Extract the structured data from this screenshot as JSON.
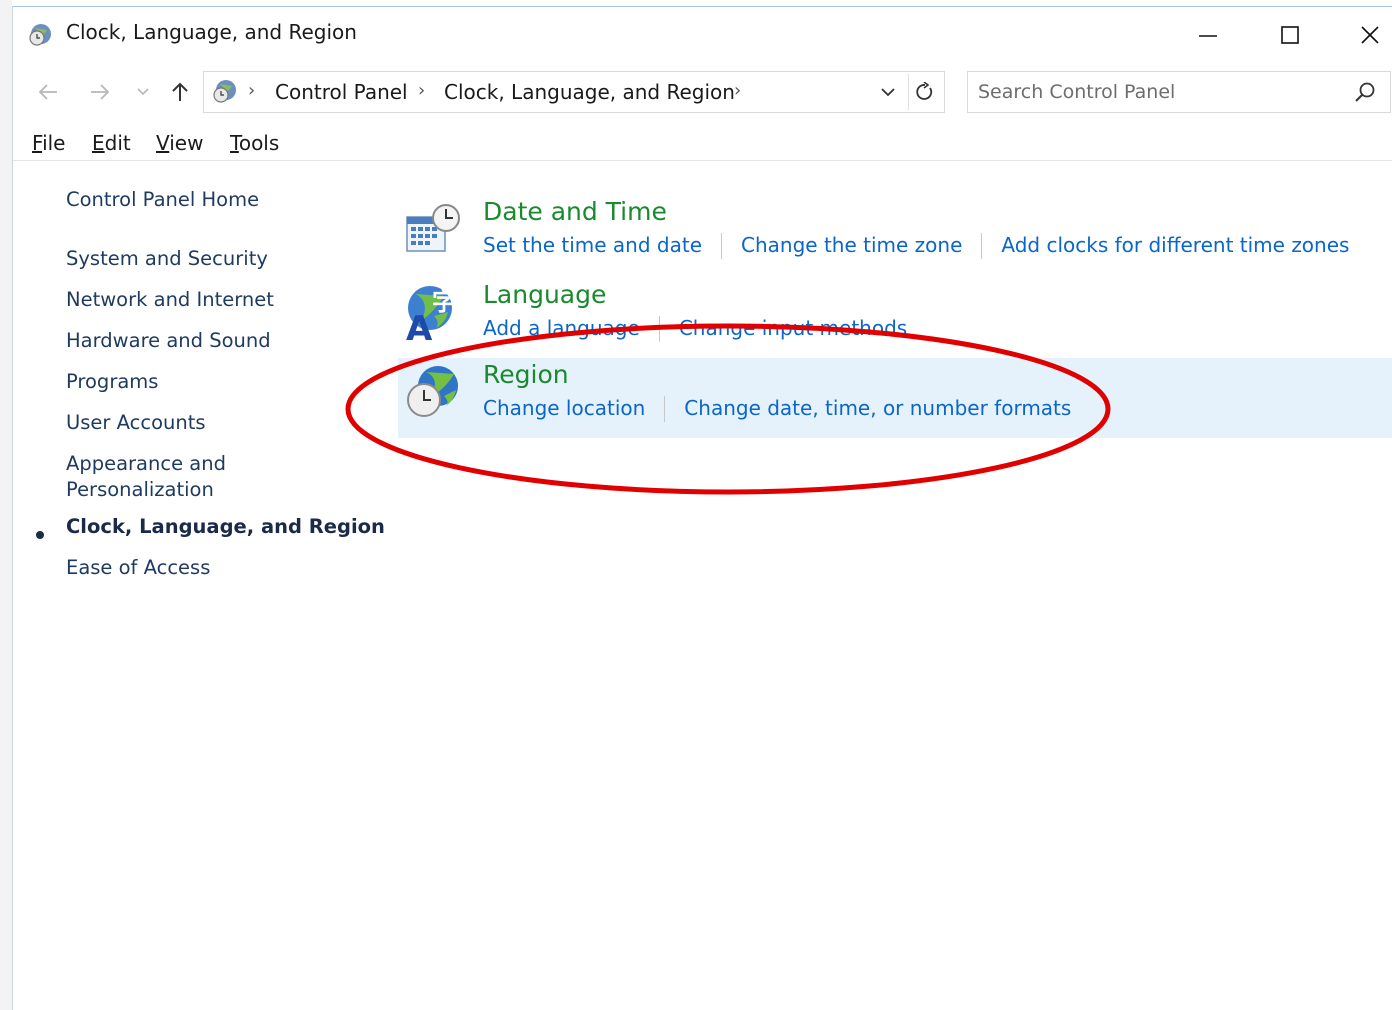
{
  "window": {
    "title": "Clock, Language, and Region",
    "controls": {
      "minimize": "minimize",
      "maximize": "maximize",
      "close": "close"
    }
  },
  "nav": {
    "breadcrumbs": [
      "Control Panel",
      "Clock, Language, and Region"
    ],
    "search_placeholder": "Search Control Panel"
  },
  "menu": {
    "items": [
      {
        "label": "File",
        "access_key": "F"
      },
      {
        "label": "Edit",
        "access_key": "E"
      },
      {
        "label": "View",
        "access_key": "V"
      },
      {
        "label": "Tools",
        "access_key": "T"
      }
    ]
  },
  "sidebar": {
    "home": "Control Panel Home",
    "items": [
      "System and Security",
      "Network and Internet",
      "Hardware and Sound",
      "Programs",
      "User Accounts",
      "Appearance and",
      "Personalization",
      "Clock, Language, and Region",
      "Ease of Access"
    ],
    "current": "Clock, Language, and Region"
  },
  "categories": [
    {
      "title": "Date and Time",
      "icon": "date-time-icon",
      "links": [
        "Set the time and date",
        "Change the time zone",
        "Add clocks for different time zones"
      ]
    },
    {
      "title": "Language",
      "icon": "language-icon",
      "links": [
        "Add a language",
        "Change input methods"
      ]
    },
    {
      "title": "Region",
      "icon": "region-icon",
      "links": [
        "Change location",
        "Change date, time, or number formats"
      ],
      "highlighted": true
    }
  ],
  "colors": {
    "category_title": "#1a8a2e",
    "link": "#0a66c9",
    "highlight_bg": "#e5f1fb",
    "annotation": "#e00000"
  }
}
